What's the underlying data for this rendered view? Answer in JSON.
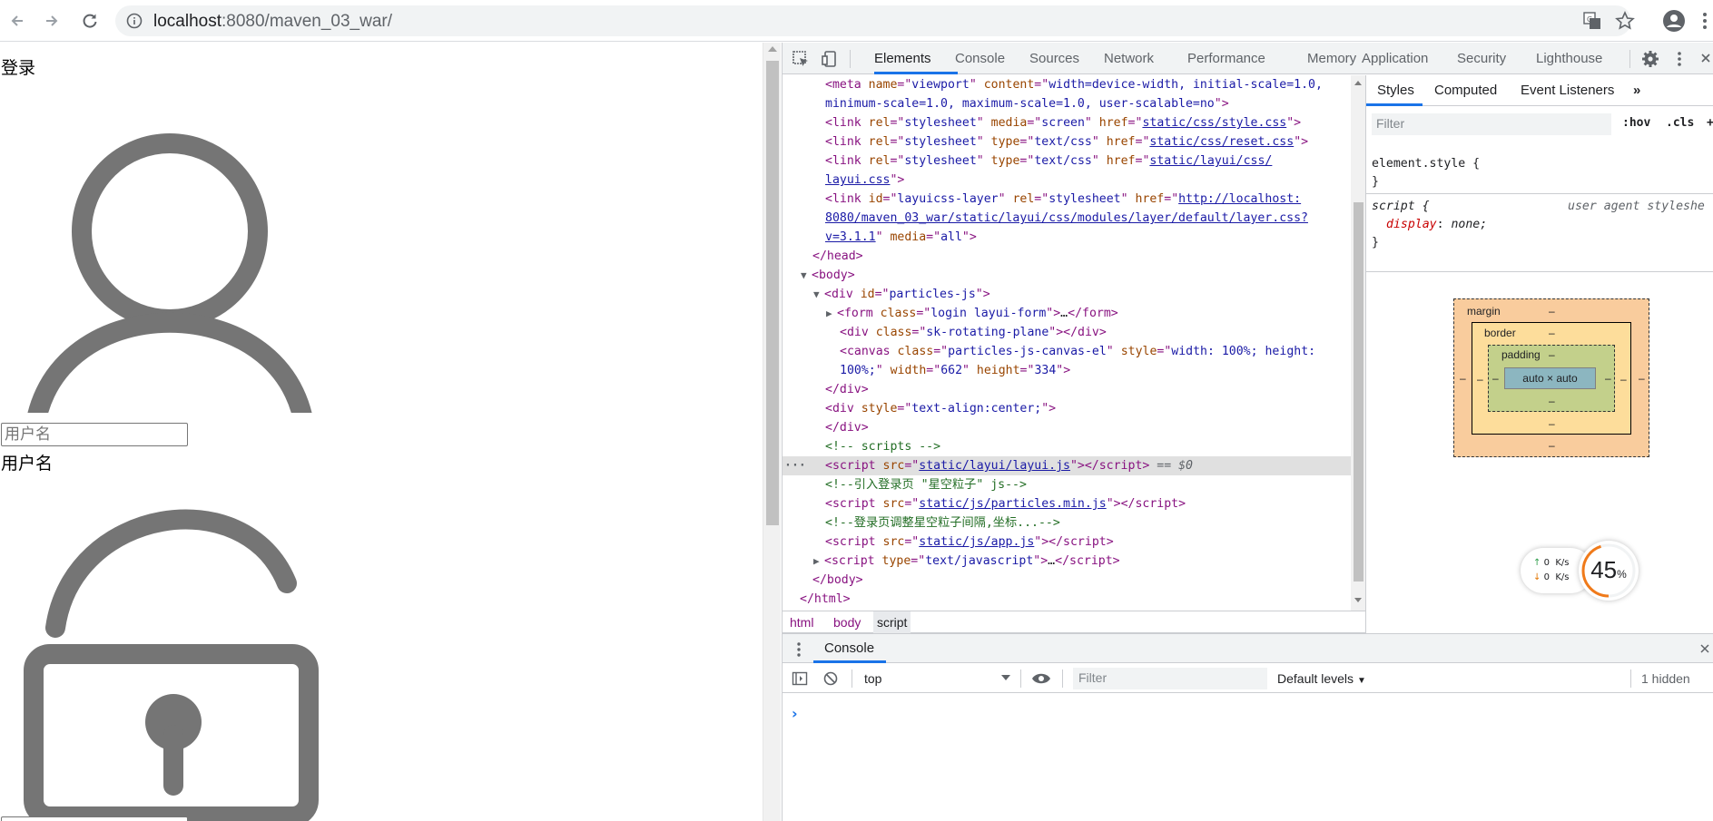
{
  "browser": {
    "url_host": "localhost",
    "url_path": ":8080/maven_03_war/"
  },
  "page": {
    "login_title": "登录",
    "username_placeholder": "用户名",
    "username_label": "用户名"
  },
  "devtools": {
    "tabs": [
      "Elements",
      "Console",
      "Sources",
      "Network",
      "Performance",
      "Memory",
      "Application",
      "Security",
      "Lighthouse"
    ],
    "active_tab": "Elements",
    "elements_lines": {
      "l1a": "<meta name=\"viewport\" content=\"width=device-width, initial-scale=1.0,",
      "l1b": "minimum-scale=1.0, maximum-scale=1.0, user-scalable=no\">",
      "l2_href": "static/css/style.css",
      "l3_href": "static/css/reset.css",
      "l4_href_a": "static/layui/css/",
      "l4_href_b": "layui.css",
      "l5_href_a": "http://localhost:",
      "l5_href_b": "8080/maven_03_war/static/layui/css/modules/layer/default/layer.css?",
      "l5_href_c": "v=3.1.1",
      "canvas_w": "662",
      "canvas_h": "334",
      "comment_scripts": "<!-- scripts -->",
      "script1_src": "static/layui/layui.js",
      "eq0": "== $0",
      "comment_particles": "<!--引入登录页 \"星空粒子\" js-->",
      "script2_src": "static/js/particles.min.js",
      "comment_adjust": "<!--登录页调整星空粒子间隔,坐标...-->",
      "script3_src": "static/js/app.js"
    },
    "breadcrumbs": [
      "html",
      "body",
      "script"
    ],
    "styles": {
      "tabs": [
        "Styles",
        "Computed",
        "Event Listeners"
      ],
      "filter_placeholder": "Filter",
      "hov": ":hov",
      "cls": ".cls",
      "element_style": "element.style {",
      "close_brace": "}",
      "script_selector": "script {",
      "ua_label": "user agent styleshe",
      "display_prop": "display",
      "display_val": "none;"
    },
    "box_model": {
      "margin_label": "margin",
      "border_label": "border",
      "padding_label": "padding",
      "content": "auto × auto",
      "dash": "–"
    },
    "net_widget": {
      "up": "0",
      "down": "0",
      "unit": "K/s",
      "percent": "45",
      "percent_sign": "%"
    },
    "drawer": {
      "tab": "Console",
      "context": "top",
      "filter_placeholder": "Filter",
      "levels": "Default levels",
      "hidden": "1 hidden"
    }
  },
  "colors": {
    "accent": "#1a73e8",
    "icon_gray": "#757575"
  }
}
